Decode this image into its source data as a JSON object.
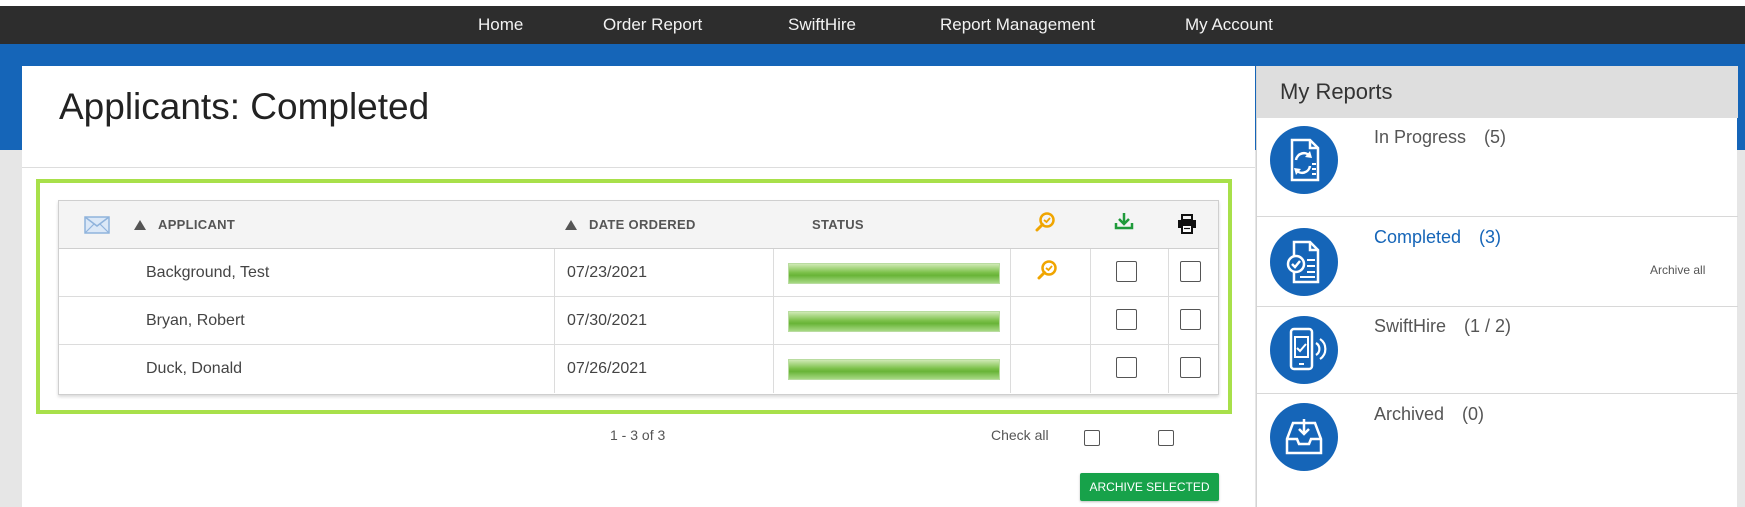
{
  "nav": {
    "items": [
      {
        "label": "Home"
      },
      {
        "label": "Order Report"
      },
      {
        "label": "SwiftHire"
      },
      {
        "label": "Report Management"
      },
      {
        "label": "My Account"
      }
    ]
  },
  "page": {
    "title": "Applicants: Completed"
  },
  "table": {
    "headers": {
      "applicant": "APPLICANT",
      "date_ordered": "DATE ORDERED",
      "status": "STATUS"
    },
    "rows": [
      {
        "applicant": "Background, Test",
        "date_ordered": "07/23/2021",
        "status_progress": 1.0,
        "has_review_icon": true
      },
      {
        "applicant": "Bryan, Robert",
        "date_ordered": "07/30/2021",
        "status_progress": 1.0,
        "has_review_icon": false
      },
      {
        "applicant": "Duck, Donald",
        "date_ordered": "07/26/2021",
        "status_progress": 1.0,
        "has_review_icon": false
      }
    ]
  },
  "footer": {
    "pager": "1 - 3 of 3",
    "check_all_label": "Check all",
    "archive_selected_label": "ARCHIVE SELECTED"
  },
  "my_reports": {
    "title": "My Reports",
    "items": [
      {
        "label": "In Progress",
        "count": "(5)",
        "icon": "refresh-document-icon"
      },
      {
        "label": "Completed",
        "count": "(3)",
        "icon": "check-document-icon"
      },
      {
        "label": "SwiftHire",
        "count": "(1 / 2)",
        "icon": "mobile-document-icon"
      },
      {
        "label": "Archived",
        "count": "(0)",
        "icon": "archive-tray-icon"
      }
    ],
    "archive_all_label": "Archive all"
  },
  "colors": {
    "nav_bg": "#2d2d2d",
    "brand_blue": "#1565b8",
    "highlight_green": "#a8e04a",
    "status_green": "#7cc14a",
    "button_green": "#17a24a",
    "review_icon_orange": "#f0a500",
    "download_icon_green": "#1f9a3a"
  }
}
